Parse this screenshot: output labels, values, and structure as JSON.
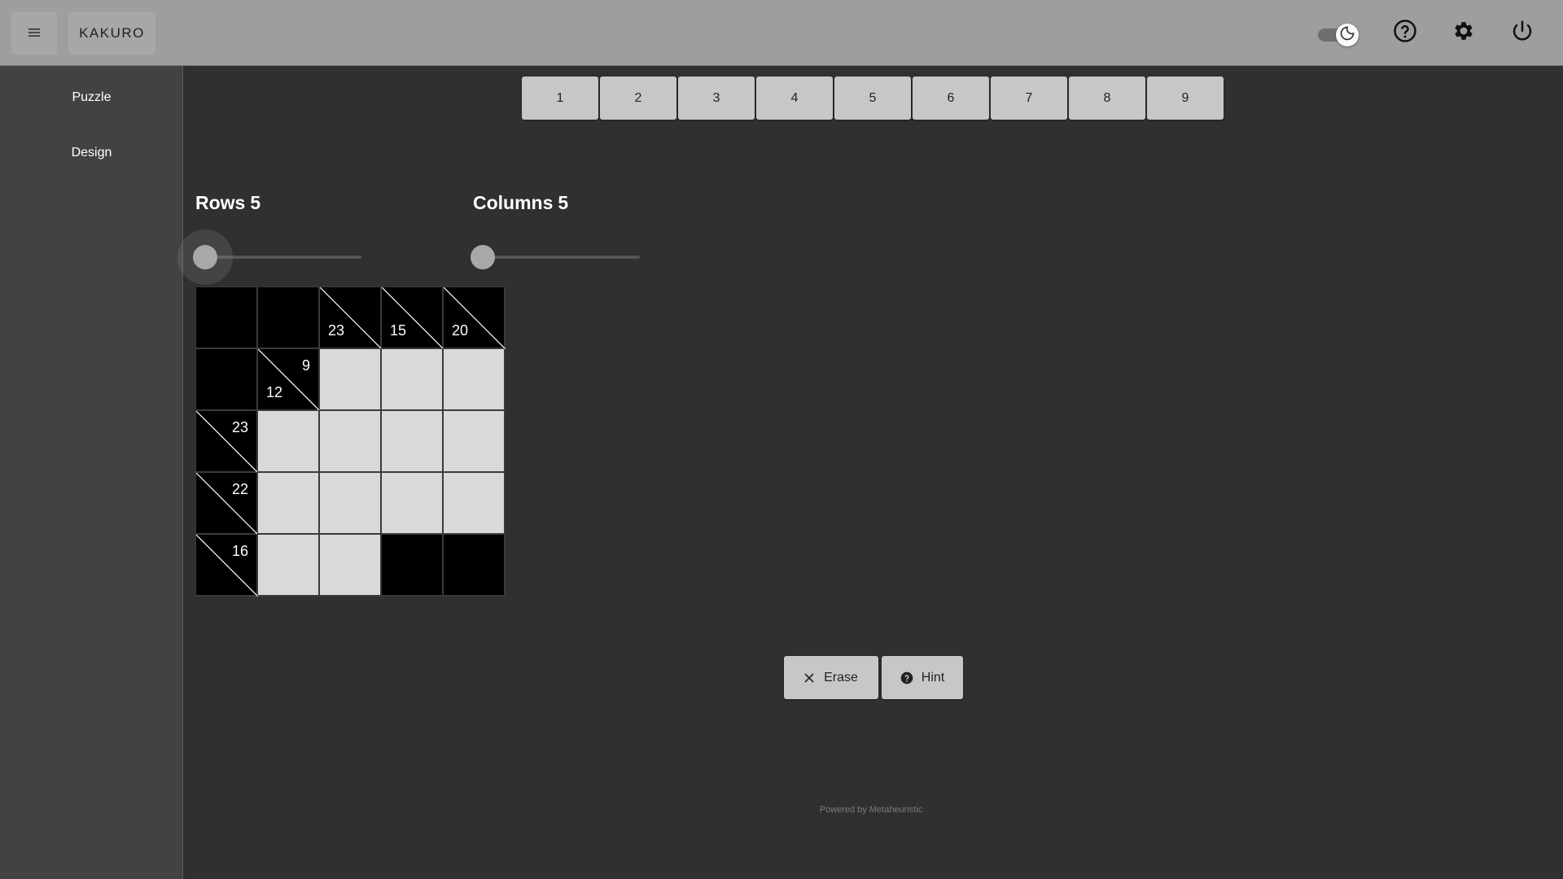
{
  "header": {
    "menu_icon": "hamburger-icon",
    "title": "KAKURO",
    "theme_toggle_icon": "moon-icon",
    "help_icon": "help-circle-icon",
    "settings_icon": "gear-icon",
    "power_icon": "power-icon"
  },
  "sidebar": {
    "items": [
      {
        "label": "Puzzle"
      },
      {
        "label": "Design"
      }
    ]
  },
  "number_pad": [
    "1",
    "2",
    "3",
    "4",
    "5",
    "6",
    "7",
    "8",
    "9"
  ],
  "rows": {
    "label": "Rows",
    "value": "5"
  },
  "columns": {
    "label": "Columns",
    "value": "5"
  },
  "grid": {
    "cells": [
      {
        "type": "black"
      },
      {
        "type": "black"
      },
      {
        "type": "clue",
        "down": "23",
        "across": ""
      },
      {
        "type": "clue",
        "down": "15",
        "across": ""
      },
      {
        "type": "clue",
        "down": "20",
        "across": ""
      },
      {
        "type": "black"
      },
      {
        "type": "clue",
        "down": "12",
        "across": "9"
      },
      {
        "type": "white"
      },
      {
        "type": "white"
      },
      {
        "type": "white"
      },
      {
        "type": "clue",
        "down": "",
        "across": "23"
      },
      {
        "type": "white"
      },
      {
        "type": "white"
      },
      {
        "type": "white"
      },
      {
        "type": "white"
      },
      {
        "type": "clue",
        "down": "",
        "across": "22"
      },
      {
        "type": "white"
      },
      {
        "type": "white"
      },
      {
        "type": "white"
      },
      {
        "type": "white"
      },
      {
        "type": "clue",
        "down": "",
        "across": "16"
      },
      {
        "type": "white"
      },
      {
        "type": "white"
      },
      {
        "type": "black"
      },
      {
        "type": "black"
      }
    ]
  },
  "actions": {
    "erase_label": "Erase",
    "erase_icon": "close-icon",
    "hint_label": "Hint",
    "hint_icon": "help-circle-icon"
  },
  "footer": {
    "prefix": "Powered by",
    "brand": "Metaheuristic"
  },
  "colors": {
    "topbar": "#9e9e9e",
    "background": "#303030",
    "sidebar": "#424242",
    "button": "#c7c7c7",
    "white_cell": "#d9d9d9",
    "black_cell": "#000000"
  }
}
